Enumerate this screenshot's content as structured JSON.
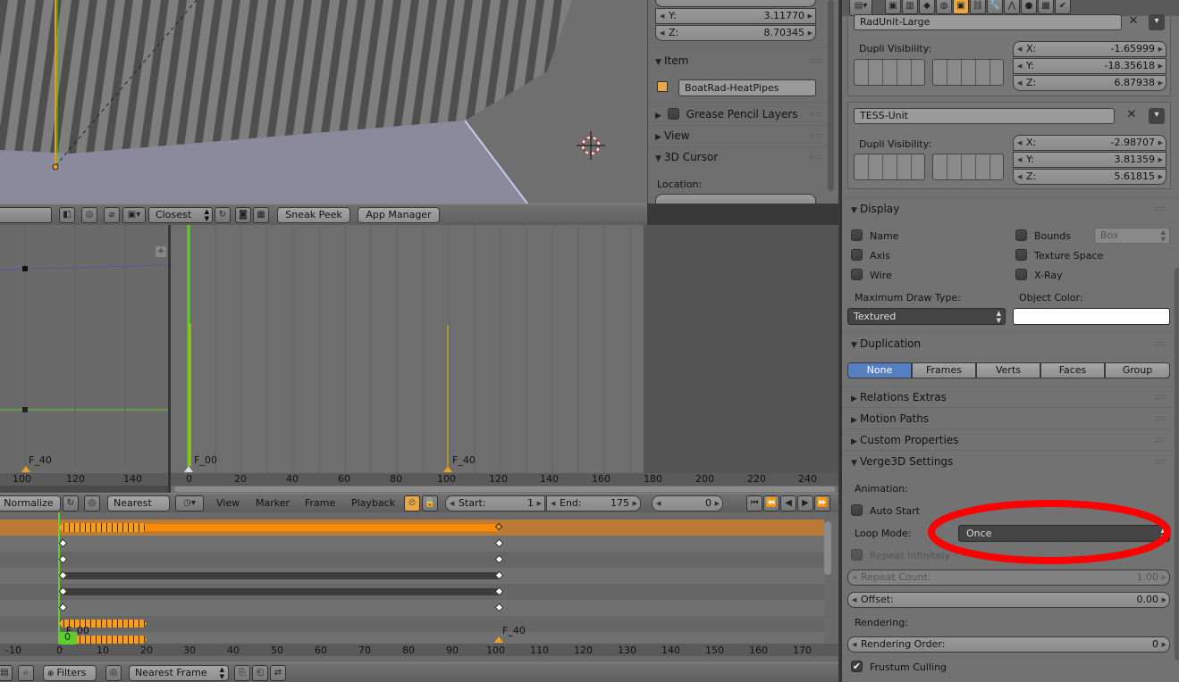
{
  "viewport_header": {
    "snap_target": "Closest",
    "sneak_peek": "Sneak Peek",
    "app_manager": "App Manager"
  },
  "n_panel": {
    "location_y_label": "Y:",
    "location_y_value": "3.11770",
    "location_z_label": "Z:",
    "location_z_value": "8.70345",
    "item_header": "Item",
    "item_name": "BoatRad-HeatPipes",
    "grease_pencil_header": "Grease Pencil Layers",
    "view_header": "View",
    "cursor_header": "3D Cursor",
    "cursor_location_label": "Location:"
  },
  "timeline": {
    "menu_view": "View",
    "menu_marker": "Marker",
    "menu_frame": "Frame",
    "menu_playback": "Playback",
    "start_label": "Start:",
    "start_value": "1",
    "end_label": "End:",
    "end_value": "175",
    "current_frame": "0",
    "marker_f00": "F_00",
    "marker_f40": "F_40",
    "ruler": [
      "0",
      "20",
      "40",
      "60",
      "80",
      "100",
      "120",
      "140",
      "160",
      "180",
      "200",
      "220",
      "240"
    ]
  },
  "graph_editor": {
    "marker_f40": "F_40",
    "ruler": [
      "100",
      "120",
      "140"
    ],
    "normalize": "Normalize",
    "snap": "Nearest Fra"
  },
  "dopesheet": {
    "ruler": [
      "-10",
      "0",
      "10",
      "20",
      "30",
      "40",
      "50",
      "60",
      "70",
      "80",
      "90",
      "100",
      "110",
      "120",
      "130",
      "140",
      "150",
      "160",
      "170"
    ],
    "marker_f00": "F_00",
    "marker_f40": "F_40",
    "current_frame": "0",
    "filters": "Filters",
    "snap": "Nearest Frame"
  },
  "properties": {
    "group1_name": "RadUnit-Large",
    "dupli_visibility_label": "Dupli Visibility:",
    "group1_x_label": "X:",
    "group1_x": "-1.65999",
    "group1_y_label": "Y:",
    "group1_y": "-18.35618",
    "group1_z_label": "Z:",
    "group1_z": "6.87938",
    "group2_name": "TESS-Unit",
    "group2_x_label": "X:",
    "group2_x": "-2.98707",
    "group2_y_label": "Y:",
    "group2_y": "3.81359",
    "group2_z_label": "Z:",
    "group2_z": "5.61815",
    "display_header": "Display",
    "name_label": "Name",
    "bounds_label": "Bounds",
    "bounds_type": "Box",
    "axis_label": "Axis",
    "texture_space_label": "Texture Space",
    "wire_label": "Wire",
    "xray_label": "X-Ray",
    "max_draw_type_label": "Maximum Draw Type:",
    "object_color_label": "Object Color:",
    "draw_type": "Textured",
    "duplication_header": "Duplication",
    "dup_none": "None",
    "dup_frames": "Frames",
    "dup_verts": "Verts",
    "dup_faces": "Faces",
    "dup_group": "Group",
    "relations_extras": "Relations Extras",
    "motion_paths": "Motion Paths",
    "custom_properties": "Custom Properties",
    "verge3d_header": "Verge3D Settings",
    "animation_label": "Animation:",
    "auto_start_label": "Auto Start",
    "loop_mode_label": "Loop Mode:",
    "loop_mode_value": "Once",
    "repeat_infinitely_label": "Repeat Infinitely",
    "repeat_count_label": "Repeat Count:",
    "repeat_count_value": "1.00",
    "offset_label": "Offset:",
    "offset_value": "0.00",
    "rendering_label": "Rendering:",
    "rendering_order_label": "Rendering Order:",
    "rendering_order_value": "0",
    "frustum_culling_label": "Frustum Culling"
  },
  "colors": {
    "accent_orange": "#f0a020",
    "selected_blue": "#5680c2",
    "highlight_red": "#ff0000",
    "playhead_green": "#5ecf2a"
  }
}
